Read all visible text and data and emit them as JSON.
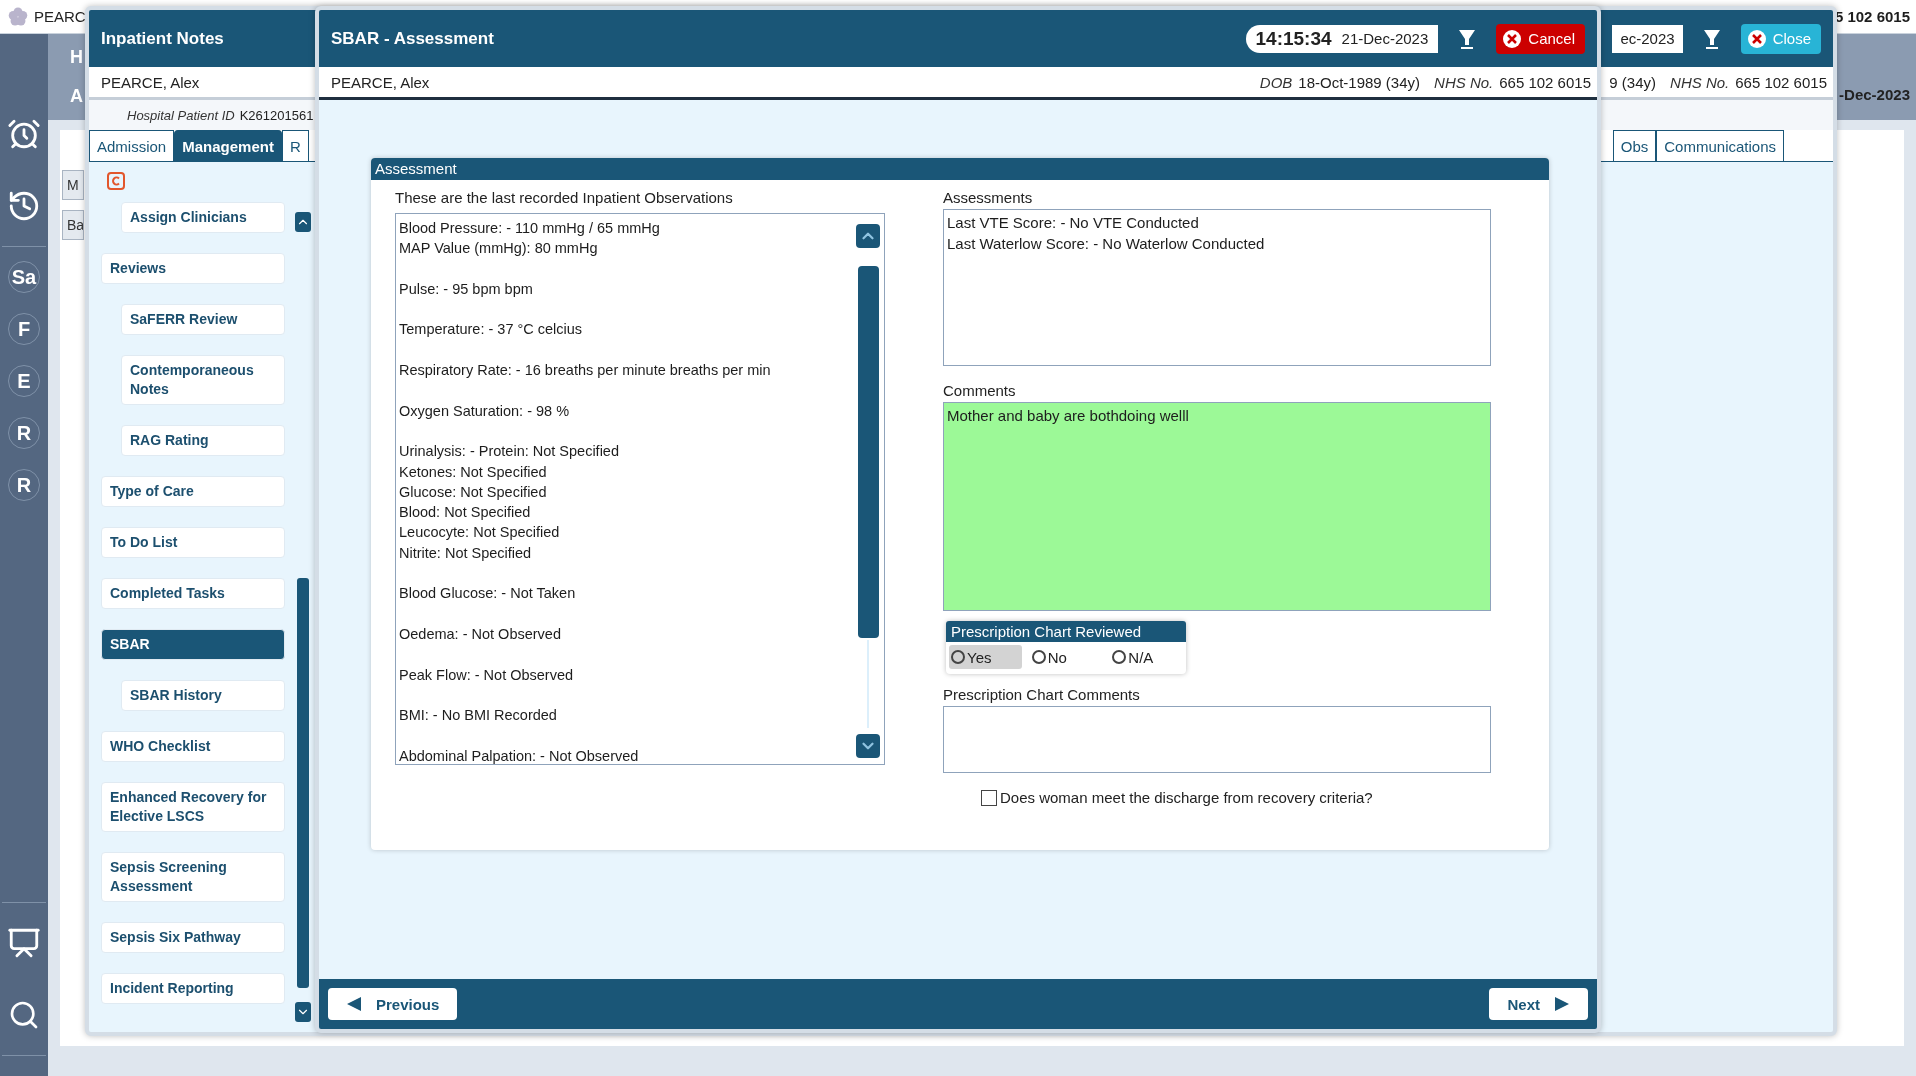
{
  "background": {
    "title": "PEARC",
    "header_letters": [
      "H",
      "A"
    ],
    "nhs_number": "5 102 6015",
    "date": "-Dec-2023",
    "side_buttons": [
      "M",
      "Ba"
    ],
    "rail_top": [
      {
        "kind": "alarm"
      },
      {
        "kind": "history"
      },
      {
        "kind": "letter",
        "label": "Sa"
      },
      {
        "kind": "letter",
        "label": "F"
      },
      {
        "kind": "letter",
        "label": "E"
      },
      {
        "kind": "letter",
        "label": "R"
      },
      {
        "kind": "letter",
        "label": "R"
      }
    ],
    "rail_bottom": [
      {
        "kind": "monitor"
      },
      {
        "kind": "search"
      }
    ]
  },
  "notes_window": {
    "title": "Inpatient Notes",
    "date_partial": "ec-2023",
    "close_label": "Close",
    "patient_name": "PEARCE, Alex",
    "dob_partial": "9 (34y)",
    "nhs_label": "NHS No.",
    "nhs_number": "665 102 6015",
    "patient_id_label": "Hospital Patient ID",
    "patient_id": "K261201561",
    "tabs_left": [
      {
        "label": "Admission",
        "selected": false
      },
      {
        "label": "Management",
        "selected": true
      },
      {
        "label": "R",
        "selected": false
      }
    ],
    "tabs_right": [
      {
        "label": "Obs",
        "selected": false
      },
      {
        "label": "Communications",
        "selected": false
      }
    ],
    "nav": [
      {
        "children": [
          {
            "label": "Assign Clinicians",
            "selected": false
          }
        ]
      },
      {
        "label": "Reviews",
        "selected": false,
        "children": [
          {
            "label": "SaFERR Review",
            "selected": false
          },
          {
            "label": "Contemporaneous Notes",
            "selected": false
          },
          {
            "label": "RAG Rating",
            "selected": false
          }
        ]
      },
      {
        "label": "Type of Care",
        "selected": false
      },
      {
        "label": "To Do List",
        "selected": false
      },
      {
        "label": "Completed Tasks",
        "selected": false
      },
      {
        "label": "SBAR",
        "selected": true,
        "children": [
          {
            "label": "SBAR History",
            "selected": false
          }
        ]
      },
      {
        "label": "WHO Checklist",
        "selected": false
      },
      {
        "label": "Enhanced Recovery for Elective LSCS",
        "selected": false
      },
      {
        "label": "Sepsis Screening Assessment",
        "selected": false
      },
      {
        "label": "Sepsis Six Pathway",
        "selected": false
      },
      {
        "label": "Incident Reporting",
        "selected": false
      }
    ]
  },
  "sbar_window": {
    "title": "SBAR - Assessment",
    "time": "14:15:34",
    "date": "21-Dec-2023",
    "cancel_label": "Cancel",
    "patient_name": "PEARCE, Alex",
    "dob_label": "DOB",
    "dob": "18-Oct-1989 (34y)",
    "nhs_label": "NHS No.",
    "nhs_number": "665 102 6015",
    "panel_title": "Assessment",
    "observations_label": "These are the last recorded Inpatient Observations",
    "observations": [
      [
        "Blood Pressure: - 110 mmHg / 65 mmHg",
        "MAP Value (mmHg): 80 mmHg"
      ],
      [
        "Pulse: - 95 bpm bpm"
      ],
      [
        "Temperature: - 37 °C celcius"
      ],
      [
        "Respiratory Rate: - 16 breaths per minute breaths per min"
      ],
      [
        "Oxygen Saturation: - 98 %"
      ],
      [
        "Urinalysis: - Protein: Not Specified",
        "Ketones: Not Specified",
        "Glucose: Not Specified",
        "Blood: Not Specified",
        "Leucocyte: Not Specified",
        "Nitrite: Not Specified"
      ],
      [
        "Blood Glucose: - Not Taken"
      ],
      [
        "Oedema: - Not Observed"
      ],
      [
        "Peak Flow: - Not Observed"
      ],
      [
        "BMI: - No BMI Recorded"
      ],
      [
        "Abdominal Palpation: - Not Observed"
      ]
    ],
    "assessments_label": "Assessments",
    "assessments": [
      "Last VTE Score: - No VTE Conducted",
      "Last Waterlow Score: - No Waterlow Conducted"
    ],
    "comments_label": "Comments",
    "comments": "Mother and baby are bothdoing welll",
    "prescription_reviewed": {
      "title": "Prescription Chart Reviewed",
      "options": [
        {
          "label": "Yes",
          "selected": false,
          "focused": true
        },
        {
          "label": "No",
          "selected": false,
          "focused": false
        },
        {
          "label": "N/A",
          "selected": false,
          "focused": false
        }
      ]
    },
    "prescription_comments_label": "Prescription Chart Comments",
    "discharge": {
      "label": "Does woman meet the discharge from recovery criteria?",
      "checked": false
    },
    "previous_label": "Previous",
    "next_label": "Next"
  }
}
